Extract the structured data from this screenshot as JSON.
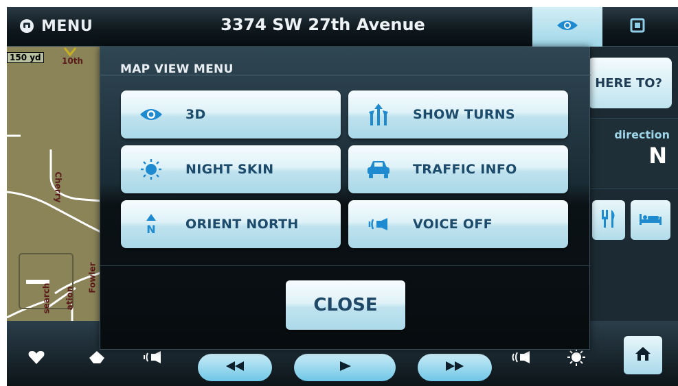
{
  "topbar": {
    "menu_label": "MENU",
    "address": "3374 SW 27th Avenue"
  },
  "map": {
    "scale": "150 yd",
    "labels": [
      "10th",
      "Cherry",
      "search",
      "ation",
      "Fowler"
    ]
  },
  "right_panel": {
    "where_to": "HERE TO?",
    "direction_label": "direction",
    "direction_value": "N"
  },
  "modal": {
    "title": "MAP VIEW MENU",
    "options": [
      {
        "label": "3D",
        "icon": "eye-icon"
      },
      {
        "label": "SHOW TURNS",
        "icon": "turn-arrows-icon"
      },
      {
        "label": "NIGHT SKIN",
        "icon": "sun-icon"
      },
      {
        "label": "TRAFFIC INFO",
        "icon": "car-icon"
      },
      {
        "label": "ORIENT NORTH",
        "icon": "north-arrow-icon"
      },
      {
        "label": "VOICE OFF",
        "icon": "speaker-icon"
      }
    ],
    "close_label": "CLOSE"
  },
  "colors": {
    "accent": "#1e8ad0",
    "button_text": "#1d4b6b"
  }
}
